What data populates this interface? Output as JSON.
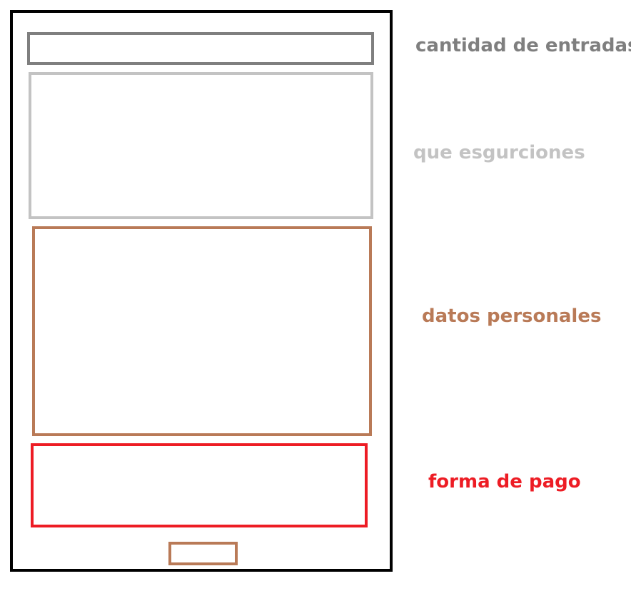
{
  "sections": {
    "cantidad": {
      "label": "cantidad de entradas",
      "color": "#7f7f7f"
    },
    "excursiones": {
      "label": "que esgurciones",
      "color": "#c3c3c3"
    },
    "datos": {
      "label": "datos personales",
      "color": "#b97a57"
    },
    "pago": {
      "label": "forma de pago",
      "color": "#ed1c24"
    }
  },
  "button": {
    "color": "#b97a57"
  },
  "frame": {
    "color": "#000000"
  }
}
